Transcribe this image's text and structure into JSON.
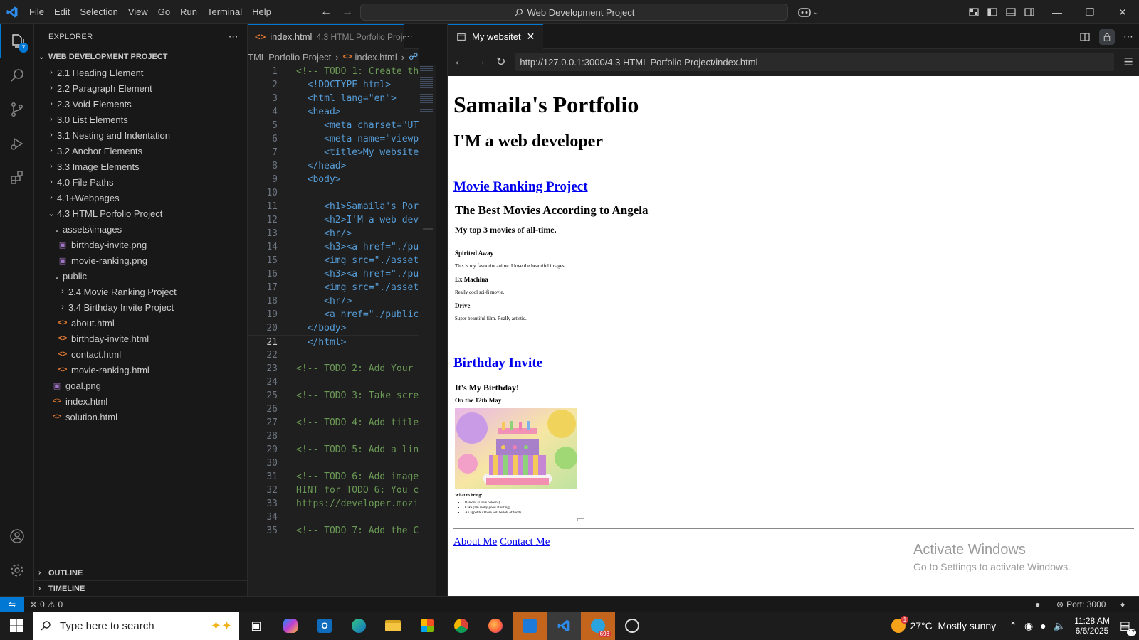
{
  "titlebar": {
    "menu": [
      "File",
      "Edit",
      "Selection",
      "View",
      "Go",
      "Run",
      "Terminal",
      "Help"
    ],
    "command_center": "Web Development Project"
  },
  "activity": {
    "explorer_badge": "7"
  },
  "sidebar": {
    "title": "EXPLORER",
    "project": "WEB DEVELOPMENT PROJECT",
    "items": [
      {
        "label": "2.1 Heading Element",
        "type": "folder",
        "level": 1,
        "open": false
      },
      {
        "label": "2.2 Paragraph Element",
        "type": "folder",
        "level": 1,
        "open": false
      },
      {
        "label": "2.3 Void Elements",
        "type": "folder",
        "level": 1,
        "open": false
      },
      {
        "label": "3.0 List Elements",
        "type": "folder",
        "level": 1,
        "open": false
      },
      {
        "label": "3.1 Nesting and Indentation",
        "type": "folder",
        "level": 1,
        "open": false
      },
      {
        "label": "3.2 Anchor Elements",
        "type": "folder",
        "level": 1,
        "open": false
      },
      {
        "label": "3.3 Image Elements",
        "type": "folder",
        "level": 1,
        "open": false
      },
      {
        "label": "4.0 File Paths",
        "type": "folder",
        "level": 1,
        "open": false
      },
      {
        "label": "4.1+Webpages",
        "type": "folder",
        "level": 1,
        "open": false
      },
      {
        "label": "4.3 HTML Porfolio Project",
        "type": "folder",
        "level": 1,
        "open": true
      },
      {
        "label": "assets\\images",
        "type": "folder",
        "level": 2,
        "open": true
      },
      {
        "label": "birthday-invite.png",
        "type": "image",
        "level": 3
      },
      {
        "label": "movie-ranking.png",
        "type": "image",
        "level": 3
      },
      {
        "label": "public",
        "type": "folder",
        "level": 2,
        "open": true
      },
      {
        "label": "2.4 Movie Ranking Project",
        "type": "folder",
        "level": 3,
        "open": false
      },
      {
        "label": "3.4 Birthday Invite Project",
        "type": "folder",
        "level": 3,
        "open": false
      },
      {
        "label": "about.html",
        "type": "html",
        "level": 3
      },
      {
        "label": "birthday-invite.html",
        "type": "html",
        "level": 3
      },
      {
        "label": "contact.html",
        "type": "html",
        "level": 3
      },
      {
        "label": "movie-ranking.html",
        "type": "html",
        "level": 3
      },
      {
        "label": "goal.png",
        "type": "image",
        "level": 2
      },
      {
        "label": "index.html",
        "type": "html",
        "level": 2
      },
      {
        "label": "solution.html",
        "type": "html",
        "level": 2
      }
    ],
    "outline": "OUTLINE",
    "timeline": "TIMELINE"
  },
  "editor": {
    "tab_label": "index.html",
    "tab_desc": "4.3 HTML Porfolio Project",
    "breadcrumb": [
      "TML Porfolio Project",
      "index.html",
      "html"
    ],
    "current_line": 21,
    "lines": [
      "<!-- TODO 1: Create th",
      "  <!DOCTYPE html>",
      "  <html lang=\"en\">",
      "  <head>",
      "     <meta charset=\"UTF",
      "     <meta name=\"viewpo",
      "     <title>My websitet",
      "  </head>",
      "  <body>",
      "",
      "     <h1>Samaila's Port",
      "     <h2>I'M a web deve",
      "     <hr/>",
      "     <h3><a href=\"./pub",
      "     <img src=\"./assets",
      "     <h3><a href=\"./pub",
      "     <img src=\"./assets",
      "     <hr/>",
      "     <a href=\"./public/",
      "  </body>",
      "  </html>",
      "",
      "<!-- TODO 2: Add Your",
      "",
      "<!-- TODO 3: Take scre",
      "",
      "<!-- TODO 4: Add title",
      "",
      "<!-- TODO 5: Add a lin",
      "",
      "<!-- TODO 6: Add image",
      "HINT for TODO 6: You c",
      "https://developer.mozi",
      "",
      "<!-- TODO 7: Add the C"
    ]
  },
  "browser": {
    "tab_title": "My websitet",
    "url": "http://127.0.0.1:3000/4.3 HTML Porfolio Project/index.html",
    "page": {
      "h1": "Samaila's Portfolio",
      "h2": "I'M a web developer",
      "link1": "Movie Ranking Project",
      "movie": {
        "title": "The Best Movies According to Angela",
        "subtitle": "My top 3 movies of all-time.",
        "items": [
          {
            "name": "Spirited Away",
            "desc": "This is my favourite anime. I love the beautiful images."
          },
          {
            "name": "Ex Machina",
            "desc": "Really cool sci-fi movie."
          },
          {
            "name": "Drive",
            "desc": "Super beautiful film. Really artistic."
          }
        ]
      },
      "link2": "Birthday Invite",
      "birthday": {
        "title": "It's My Birthday!",
        "subtitle": "On the 12th May",
        "bring_label": "What to bring:",
        "bring": [
          "Baloons (I love baloons)",
          "Cake (I'm really good at eating)",
          "An appetite (There will be lots of food)"
        ]
      },
      "about": "About Me",
      "contact": "Contact Me"
    },
    "watermark_1": "Activate Windows",
    "watermark_2": "Go to Settings to activate Windows."
  },
  "status": {
    "errors": "0",
    "warnings": "0",
    "port": "Port: 3000"
  },
  "taskbar": {
    "search_placeholder": "Type here to search",
    "telegram_badge": "693",
    "weather": "27°C  Mostly sunny",
    "weather_badge": "1",
    "time": "11:28 AM",
    "date": "6/6/2025",
    "notifications": "17"
  }
}
